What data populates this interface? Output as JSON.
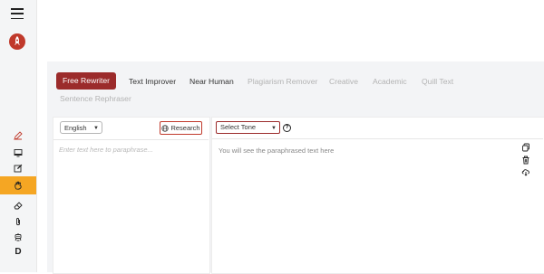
{
  "sidebar": {
    "items": [
      {
        "icon": "pencil-icon"
      },
      {
        "icon": "monitor-icon"
      },
      {
        "icon": "edit-icon"
      },
      {
        "icon": "hand-icon",
        "active": true
      },
      {
        "icon": "eraser-icon"
      },
      {
        "icon": "paperclip-icon"
      },
      {
        "icon": "robot-icon"
      },
      {
        "icon": "d-letter-icon",
        "label": "D"
      }
    ],
    "active_color": "#f5a623"
  },
  "tabs": [
    {
      "label": "Free Rewriter",
      "active": true
    },
    {
      "label": "Text Improver"
    },
    {
      "label": "Near Human"
    },
    {
      "label": "Plagiarism Remover"
    },
    {
      "label": "Creative"
    },
    {
      "label": "Academic"
    },
    {
      "label": "Quill Text"
    },
    {
      "label": "Sentence Rephraser"
    }
  ],
  "input": {
    "language": "English",
    "research_label": "Research",
    "placeholder": "Enter text here to paraphrase..."
  },
  "output": {
    "tone_label": "Select Tone",
    "placeholder": "You will see the paraphrased text here"
  },
  "colors": {
    "brand": "#9b2b2b",
    "accent": "#f5a623"
  }
}
